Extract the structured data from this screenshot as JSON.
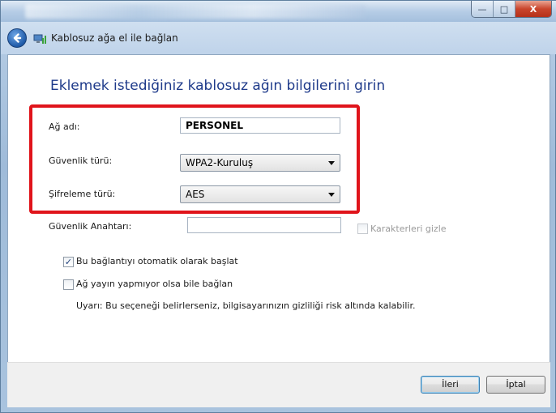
{
  "window": {
    "minimize_symbol": "—",
    "maximize_symbol": "□",
    "close_symbol": "X"
  },
  "nav": {
    "title": "Kablosuz ağa el ile bağlan"
  },
  "page": {
    "heading": "Eklemek istediğiniz kablosuz ağın bilgilerini girin"
  },
  "form": {
    "network_name_label": "Ağ adı:",
    "network_name_value": "PERSONEL",
    "security_type_label": "Güvenlik türü:",
    "security_type_value": "WPA2-Kuruluş",
    "encryption_type_label": "Şifreleme türü:",
    "encryption_type_value": "AES",
    "security_key_label": "Güvenlik Anahtarı:",
    "security_key_value": "",
    "hide_characters_label": "Karakterleri gizle",
    "hide_characters_checked": false
  },
  "options": {
    "auto_connect_label": "Bu bağlantıyı otomatik olarak başlat",
    "auto_connect_checked": true,
    "connect_hidden_label": "Ağ yayın yapmıyor olsa bile bağlan",
    "connect_hidden_checked": false,
    "warning_text": "Uyarı: Bu seçeneği belirlerseniz, bilgisayarınızın gizliliği risk altında kalabilir."
  },
  "buttons": {
    "next_label": "İleri",
    "cancel_label": "İptal"
  },
  "icons": {
    "back": "back-arrow-icon",
    "network": "wireless-network-icon",
    "check": "✓"
  },
  "colors": {
    "heading": "#1e3a8a",
    "highlight": "#e0141b",
    "close_button": "#c9452c"
  }
}
